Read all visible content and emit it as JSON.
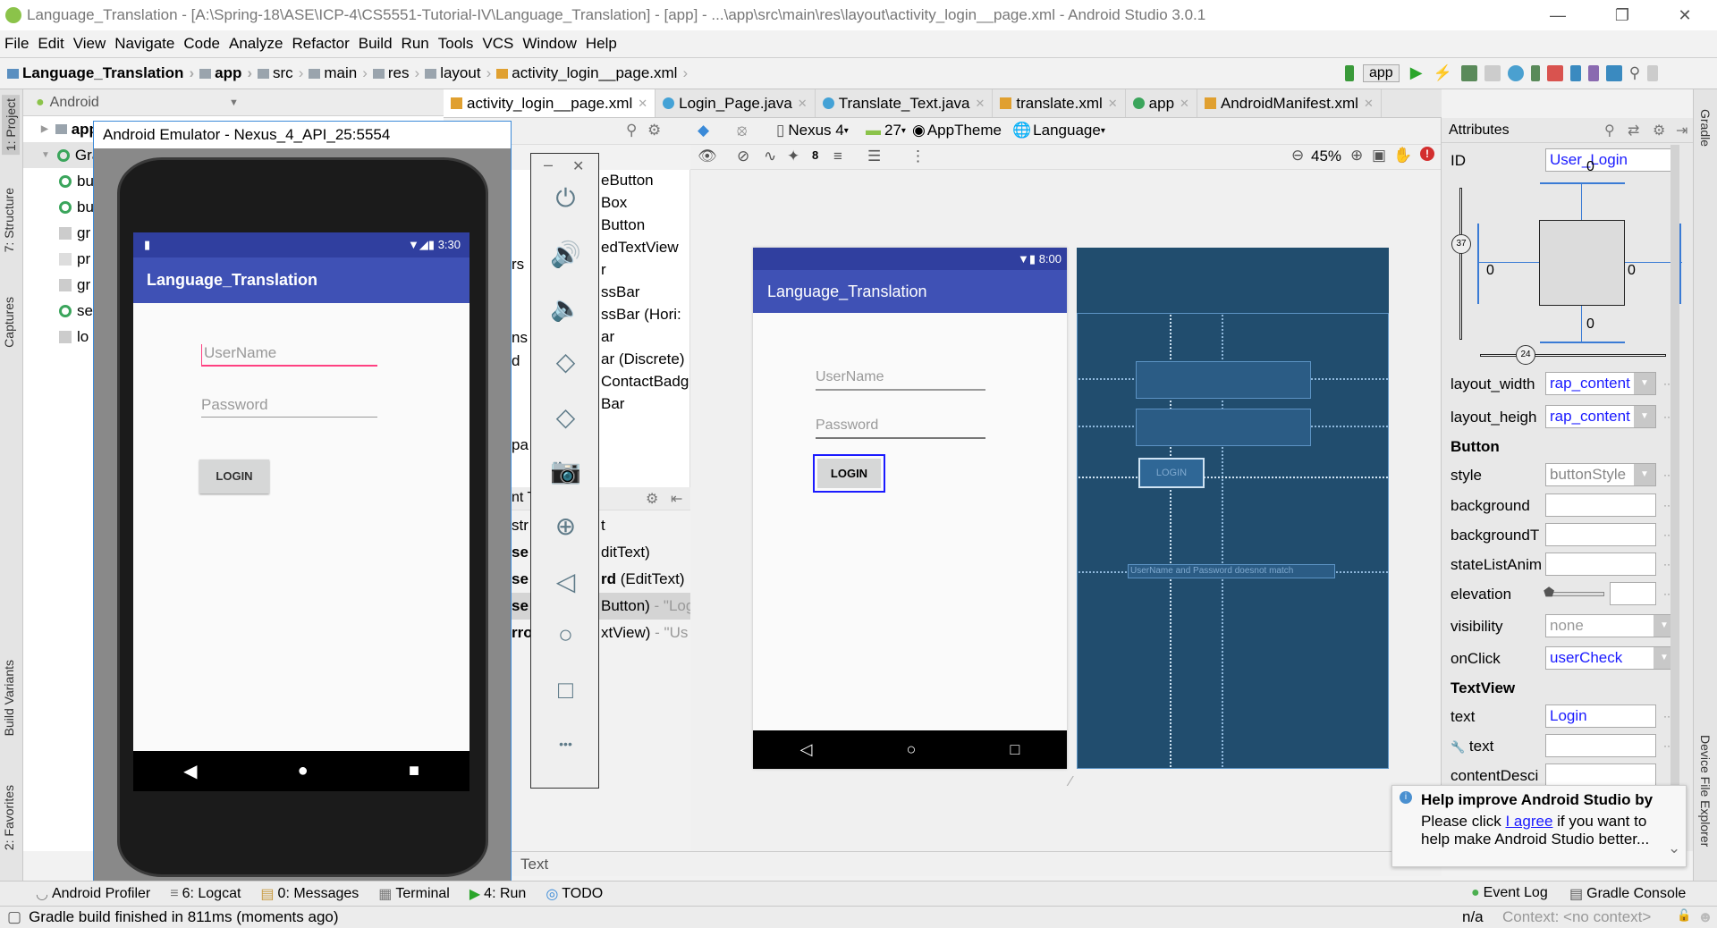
{
  "window": {
    "title": "Language_Translation - [A:\\Spring-18\\ASE\\ICP-4\\CS5551-Tutorial-IV\\Language_Translation] - [app] - ...\\app\\src\\main\\res\\layout\\activity_login__page.xml - Android Studio 3.0.1",
    "minimize": "—",
    "maximize": "❐",
    "close": "✕"
  },
  "menu": [
    "File",
    "Edit",
    "View",
    "Navigate",
    "Code",
    "Analyze",
    "Refactor",
    "Build",
    "Run",
    "Tools",
    "VCS",
    "Window",
    "Help"
  ],
  "breadcrumb": [
    "Language_Translation",
    "app",
    "src",
    "main",
    "res",
    "layout",
    "activity_login__page.xml"
  ],
  "run_config": "app",
  "left_tabs": [
    "1: Project",
    "7: Structure",
    "Captures",
    "Build Variants",
    "2: Favorites"
  ],
  "right_tabs": [
    "Gradle",
    "Device File Explorer"
  ],
  "project": {
    "view": "Android",
    "items": [
      "app",
      "Grac",
      "bu",
      "bu",
      "gr",
      "pr",
      "gr",
      "se",
      "lo"
    ]
  },
  "editor_tabs": [
    "activity_login__page.xml",
    "Login_Page.java",
    "Translate_Text.java",
    "translate.xml",
    "app",
    "AndroidManifest.xml"
  ],
  "design_toolbar": {
    "device": "Nexus 4",
    "api": "27",
    "theme": "AppTheme",
    "locale": "Language",
    "zoom": "45%",
    "margin": "8"
  },
  "palette": {
    "categories": [
      "rs",
      "ns",
      "d",
      "pa"
    ],
    "items": [
      "eButton",
      "Box",
      "Button",
      "edTextView",
      "r",
      "ssBar",
      "ssBar (Hori:",
      "ar",
      "ar (Discrete)",
      "ContactBadg",
      "Bar"
    ]
  },
  "component_tree": {
    "header": "nt T",
    "items": [
      {
        "a": "str",
        "b": "t"
      },
      {
        "a": "se",
        "b": "ditText)"
      },
      {
        "a": "se",
        "b": "rd",
        "c": " (EditText)"
      },
      {
        "a": "se",
        "b": "Button)",
        "c": " - \"Log"
      },
      {
        "a": "rro",
        "b": "xtView)",
        "c": " - \"Us"
      }
    ]
  },
  "emulator": {
    "title": "Android Emulator - Nexus_4_API_25:5554",
    "time": "3:30",
    "app_title": "Language_Translation",
    "username_hint": "UserName",
    "password_hint": "Password",
    "login_button": "LOGIN",
    "tools": {
      "minimize": "–",
      "close": "✕",
      "more": "•••"
    }
  },
  "preview": {
    "time": "8:00",
    "app_title": "Language_Translation",
    "username_hint": "UserName",
    "password_hint": "Password",
    "login_button": "LOGIN",
    "blueprint_login": "LOGIN",
    "blueprint_error": "UserName and Password doesnot match"
  },
  "attributes": {
    "title": "Attributes",
    "id_label": "ID",
    "id": "User_Login",
    "constraints": {
      "top": "0",
      "bottom": "0",
      "left": "0",
      "right": "0",
      "vertical_bias": "37",
      "horizontal_bias": "24"
    },
    "layout_width": {
      "label": "layout_width",
      "value": "rap_content"
    },
    "layout_height": {
      "label": "layout_heigh",
      "value": "rap_content"
    },
    "button_section": "Button",
    "style": {
      "label": "style",
      "value": "buttonStyle"
    },
    "background": {
      "label": "background",
      "value": ""
    },
    "backgroundTint": {
      "label": "backgroundT",
      "value": ""
    },
    "stateListAnimator": {
      "label": "stateListAnim",
      "value": ""
    },
    "elevation": {
      "label": "elevation",
      "value": ""
    },
    "visibility": {
      "label": "visibility",
      "value": "none"
    },
    "onClick": {
      "label": "onClick",
      "value": "userCheck"
    },
    "textview_section": "TextView",
    "text": {
      "label": "text",
      "value": "Login"
    },
    "tools_text": {
      "label": "text",
      "value": ""
    },
    "contentDescription": {
      "label": "contentDesci",
      "value": ""
    }
  },
  "bottom_tab": "Text",
  "tool_windows": [
    "Android Profiler",
    "6: Logcat",
    "0: Messages",
    "Terminal",
    "4: Run",
    "TODO"
  ],
  "tool_windows_right": [
    "Event Log",
    "Gradle Console"
  ],
  "status": {
    "message": "Gradle build finished in 811ms (moments ago)",
    "position": "n/a",
    "context": "Context: <no context>"
  },
  "notification": {
    "title": "Help improve Android Studio by",
    "pre": "Please click ",
    "link": "I agree",
    "post": " if you want to",
    "line2": "help make Android Studio better..."
  },
  "colors": {
    "primary": "#3f51b5",
    "primary_dark": "#303f9f",
    "blueprint": "#214d6e",
    "accent": "#ff4081",
    "link": "#1a1aff"
  }
}
